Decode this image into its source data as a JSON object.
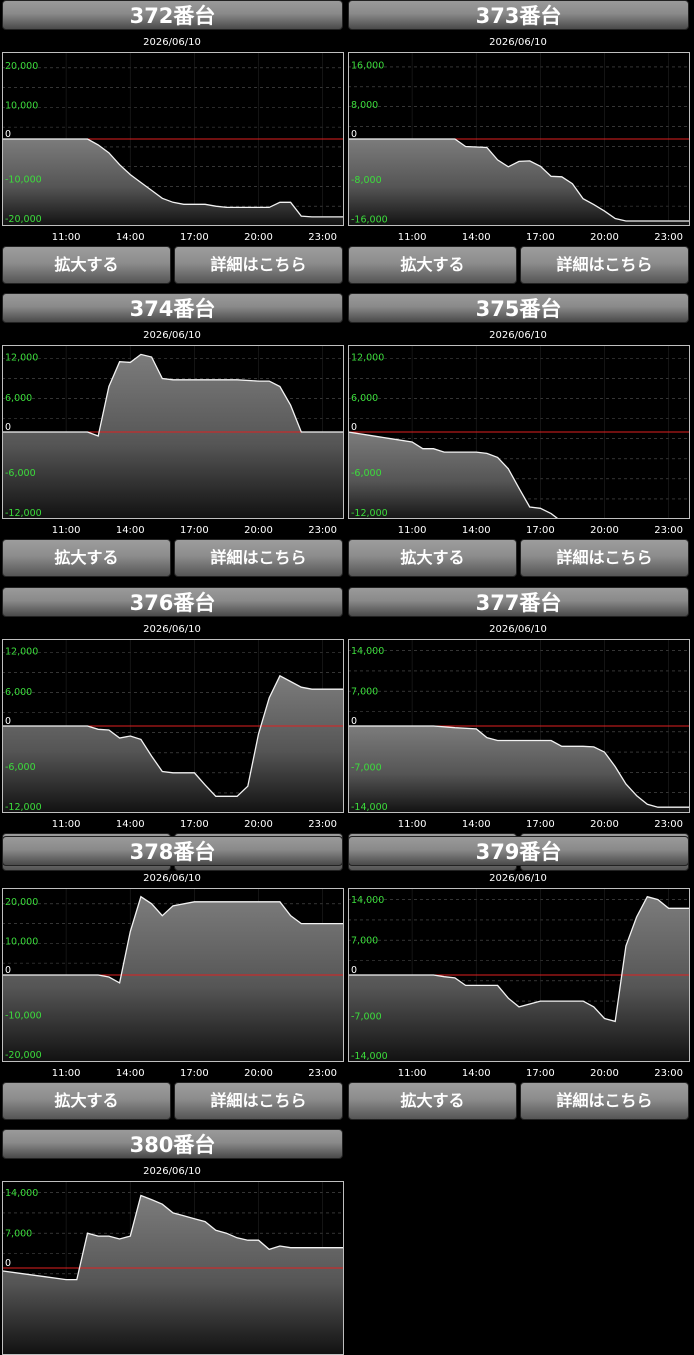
{
  "buttons": {
    "zoom": "拡大する",
    "detail": "詳細はこちら"
  },
  "chart_data": [
    {
      "type": "area",
      "title": "372番台",
      "subtitle": "2026/06/10",
      "ylim": [
        -22000,
        22000
      ],
      "yticks": [
        20000,
        10000,
        0,
        -10000,
        -20000
      ],
      "ytick_labels": [
        "20,000",
        "10,000",
        "0",
        "-10,000",
        "-20,000"
      ],
      "xtick_labels": [
        "11:00",
        "14:00",
        "17:00",
        "20:00",
        "23:00"
      ],
      "x": [
        "08:00",
        "09:00",
        "10:00",
        "11:00",
        "12:00",
        "12:30",
        "13:00",
        "13:30",
        "14:00",
        "14:30",
        "15:00",
        "15:30",
        "16:00",
        "16:30",
        "17:00",
        "17:30",
        "18:00",
        "18:30",
        "19:00",
        "19:30",
        "20:00",
        "20:30",
        "21:00",
        "21:30",
        "22:00",
        "22:30",
        "23:00",
        "23:30",
        "24:00"
      ],
      "values": [
        0,
        0,
        0,
        0,
        0,
        -1500,
        -3500,
        -6500,
        -9000,
        -11000,
        -13000,
        -15000,
        -16000,
        -16500,
        -16500,
        -16500,
        -17000,
        -17300,
        -17300,
        -17300,
        -17300,
        -17300,
        -16000,
        -16000,
        -19500,
        -19700,
        -19700,
        -19700,
        -19700
      ]
    },
    {
      "type": "area",
      "title": "373番台",
      "subtitle": "2026/06/10",
      "ylim": [
        -17500,
        17500
      ],
      "yticks": [
        16000,
        8000,
        0,
        -8000,
        -16000
      ],
      "ytick_labels": [
        "16,000",
        "8,000",
        "0",
        "-8,000",
        "-16,000"
      ],
      "xtick_labels": [
        "11:00",
        "14:00",
        "17:00",
        "20:00",
        "23:00"
      ],
      "x": [
        "08:00",
        "09:00",
        "10:00",
        "11:00",
        "12:00",
        "13:00",
        "13:30",
        "14:00",
        "14:30",
        "15:00",
        "15:30",
        "16:00",
        "16:30",
        "17:00",
        "17:30",
        "18:00",
        "18:30",
        "19:00",
        "19:30",
        "20:00",
        "20:30",
        "21:00",
        "22:00",
        "23:00",
        "24:00"
      ],
      "values": [
        0,
        0,
        0,
        0,
        0,
        0,
        -1500,
        -1600,
        -1700,
        -4200,
        -5600,
        -4500,
        -4400,
        -5500,
        -7500,
        -7600,
        -9000,
        -12000,
        -13200,
        -14500,
        -16000,
        -16500,
        -16500,
        -16500,
        -16500
      ]
    },
    {
      "type": "area",
      "title": "374番台",
      "subtitle": "2026/06/10",
      "ylim": [
        -13000,
        13000
      ],
      "yticks": [
        12000,
        6000,
        0,
        -6000,
        -12000
      ],
      "ytick_labels": [
        "12,000",
        "6,000",
        "0",
        "-6,000",
        "-12,000"
      ],
      "xtick_labels": [
        "11:00",
        "14:00",
        "17:00",
        "20:00",
        "23:00"
      ],
      "x": [
        "08:00",
        "09:00",
        "10:00",
        "11:00",
        "12:00",
        "12:30",
        "13:00",
        "13:30",
        "14:00",
        "14:30",
        "15:00",
        "15:30",
        "16:00",
        "17:00",
        "18:00",
        "19:00",
        "20:00",
        "20:30",
        "21:00",
        "21:30",
        "22:00",
        "23:00",
        "24:00"
      ],
      "values": [
        0,
        0,
        0,
        0,
        0,
        -600,
        6800,
        10500,
        10400,
        11600,
        11200,
        8000,
        7800,
        7800,
        7800,
        7800,
        7600,
        7600,
        6800,
        4000,
        0,
        0,
        0
      ]
    },
    {
      "type": "area",
      "title": "375番台",
      "subtitle": "2026/06/10",
      "ylim": [
        -13000,
        13000
      ],
      "yticks": [
        12000,
        6000,
        0,
        -6000,
        -12000
      ],
      "ytick_labels": [
        "12,000",
        "6,000",
        "0",
        "-6,000",
        "-12,000"
      ],
      "xtick_labels": [
        "11:00",
        "14:00",
        "17:00",
        "20:00",
        "23:00"
      ],
      "x": [
        "08:00",
        "09:00",
        "10:00",
        "11:00",
        "11:30",
        "12:00",
        "12:30",
        "13:00",
        "14:00",
        "14:30",
        "15:00",
        "15:30",
        "16:00",
        "16:30",
        "17:00",
        "17:30",
        "18:00",
        "18:30",
        "19:00",
        "20:00",
        "21:00",
        "22:00",
        "23:00",
        "24:00"
      ],
      "values": [
        0,
        -500,
        -1000,
        -1500,
        -2500,
        -2500,
        -3000,
        -3000,
        -3000,
        -3200,
        -3800,
        -5500,
        -8400,
        -11200,
        -11400,
        -12200,
        -13400,
        -13000,
        -13000,
        -13000,
        -13000,
        -13000,
        -13000,
        -13000
      ]
    },
    {
      "type": "area",
      "title": "376番台",
      "subtitle": "2026/06/10",
      "ylim": [
        -13000,
        13000
      ],
      "yticks": [
        12000,
        6000,
        0,
        -6000,
        -12000
      ],
      "ytick_labels": [
        "12,000",
        "6,000",
        "0",
        "-6,000",
        "-12,000"
      ],
      "xtick_labels": [
        "11:00",
        "14:00",
        "17:00",
        "20:00",
        "23:00"
      ],
      "x": [
        "08:00",
        "09:00",
        "10:00",
        "11:00",
        "12:00",
        "12:30",
        "13:00",
        "13:30",
        "14:00",
        "14:30",
        "15:00",
        "15:30",
        "16:00",
        "16:30",
        "17:00",
        "17:30",
        "18:00",
        "18:30",
        "19:00",
        "19:30",
        "20:00",
        "20:30",
        "21:00",
        "22:00",
        "22:30",
        "23:00",
        "24:00"
      ],
      "values": [
        0,
        0,
        0,
        0,
        0,
        -500,
        -600,
        -1800,
        -1500,
        -2000,
        -4500,
        -6800,
        -7000,
        -7000,
        -7000,
        -8800,
        -10500,
        -10500,
        -10500,
        -9000,
        -1200,
        4200,
        7500,
        5800,
        5500,
        5500,
        5500
      ]
    },
    {
      "type": "area",
      "title": "377番台",
      "subtitle": "2026/06/10",
      "ylim": [
        -15000,
        15000
      ],
      "yticks": [
        14000,
        7000,
        0,
        -7000,
        -14000
      ],
      "ytick_labels": [
        "14,000",
        "7,000",
        "0",
        "-7,000",
        "-14,000"
      ],
      "xtick_labels": [
        "11:00",
        "14:00",
        "17:00",
        "20:00",
        "23:00"
      ],
      "x": [
        "08:00",
        "09:00",
        "10:00",
        "11:00",
        "12:00",
        "13:00",
        "14:00",
        "14:30",
        "15:00",
        "16:00",
        "17:00",
        "17:30",
        "18:00",
        "18:30",
        "19:00",
        "19:30",
        "20:00",
        "20:30",
        "21:00",
        "21:30",
        "22:00",
        "22:30",
        "23:00",
        "24:00"
      ],
      "values": [
        0,
        0,
        0,
        0,
        0,
        -300,
        -500,
        -2000,
        -2500,
        -2500,
        -2500,
        -2500,
        -3500,
        -3500,
        -3500,
        -3600,
        -4500,
        -7000,
        -10000,
        -12000,
        -13500,
        -14000,
        -14000,
        -14000
      ]
    },
    {
      "type": "area",
      "title": "378番台",
      "subtitle": "2026/06/10",
      "ylim": [
        -22000,
        22000
      ],
      "yticks": [
        20000,
        10000,
        0,
        -10000,
        -20000
      ],
      "ytick_labels": [
        "20,000",
        "10,000",
        "0",
        "-10,000",
        "-20,000"
      ],
      "xtick_labels": [
        "11:00",
        "14:00",
        "17:00",
        "20:00",
        "23:00"
      ],
      "x": [
        "08:00",
        "09:00",
        "10:00",
        "11:00",
        "12:00",
        "12:30",
        "13:00",
        "13:30",
        "14:00",
        "14:30",
        "15:00",
        "15:30",
        "16:00",
        "17:00",
        "18:00",
        "19:00",
        "20:00",
        "21:00",
        "21:30",
        "22:00",
        "23:00",
        "24:00"
      ],
      "values": [
        0,
        0,
        0,
        0,
        0,
        0,
        -500,
        -2000,
        11000,
        19800,
        18000,
        15000,
        17500,
        18500,
        18500,
        18500,
        18500,
        18500,
        15000,
        13000,
        13000,
        13000
      ]
    },
    {
      "type": "area",
      "title": "379番台",
      "subtitle": "2026/06/10",
      "ylim": [
        -15000,
        15000
      ],
      "yticks": [
        14000,
        7000,
        0,
        -7000,
        -14000
      ],
      "ytick_labels": [
        "14,000",
        "7,000",
        "0",
        "-7,000",
        "-14,000"
      ],
      "xtick_labels": [
        "11:00",
        "14:00",
        "17:00",
        "20:00",
        "23:00"
      ],
      "x": [
        "08:00",
        "09:00",
        "10:00",
        "11:00",
        "12:00",
        "12:30",
        "13:00",
        "13:30",
        "14:00",
        "14:30",
        "15:00",
        "15:30",
        "16:00",
        "17:00",
        "18:00",
        "18:30",
        "19:00",
        "19:30",
        "20:00",
        "20:30",
        "21:00",
        "21:30",
        "22:00",
        "22:30",
        "23:00",
        "23:30",
        "24:00"
      ],
      "values": [
        0,
        0,
        0,
        0,
        0,
        -300,
        -500,
        -1800,
        -1800,
        -1800,
        -1800,
        -4000,
        -5500,
        -4500,
        -4500,
        -4500,
        -4500,
        -5500,
        -7500,
        -8000,
        5000,
        10000,
        13500,
        13000,
        11500,
        11500,
        11500
      ]
    },
    {
      "type": "area",
      "title": "380番台",
      "subtitle": "2026/06/10",
      "ylim": [
        -15000,
        15000
      ],
      "yticks": [
        14000,
        7000,
        0
      ],
      "ytick_labels": [
        "14,000",
        "7,000",
        "0"
      ],
      "xtick_labels": [],
      "x": [
        "08:00",
        "09:00",
        "10:00",
        "11:00",
        "11:30",
        "12:00",
        "12:30",
        "13:00",
        "13:30",
        "14:00",
        "14:30",
        "15:00",
        "15:30",
        "16:00",
        "16:30",
        "17:00",
        "17:30",
        "18:00",
        "18:30",
        "19:00",
        "19:30",
        "20:00",
        "20:30",
        "21:00",
        "21:30",
        "22:00",
        "23:00",
        "24:00"
      ],
      "values": [
        -500,
        -1000,
        -1500,
        -2000,
        -2000,
        6000,
        5500,
        5500,
        5000,
        5500,
        12500,
        11800,
        11000,
        9500,
        9000,
        8500,
        8000,
        6500,
        6000,
        5200,
        4800,
        4800,
        3200,
        3800,
        3500,
        3500,
        3500,
        3500
      ]
    }
  ]
}
